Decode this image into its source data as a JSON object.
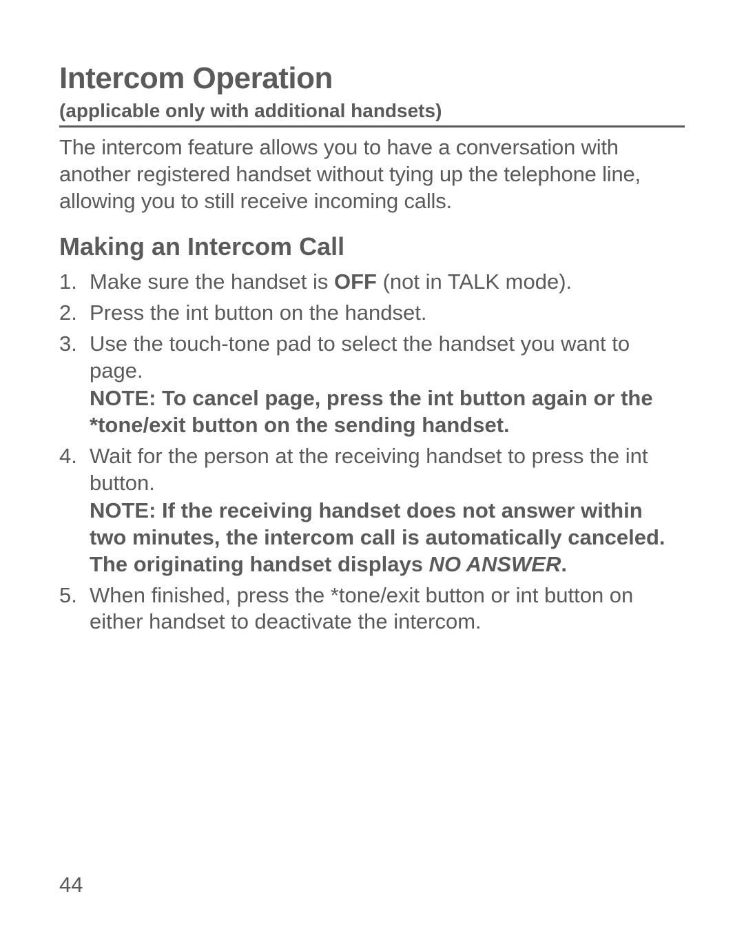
{
  "header": {
    "title": "Intercom Operation",
    "subtitle": "(applicable only with additional handsets)"
  },
  "intro": "The intercom feature allows you to have a conversation with another registered handset without tying up the telephone line, allowing you to still receive incoming calls.",
  "section_title": "Making an Intercom Call",
  "steps": {
    "s1_a": "Make sure the handset is ",
    "s1_off": "OFF",
    "s1_b": " (not in TALK mode).",
    "s2": "Press the int button on the handset.",
    "s3_a": "Use the touch-tone pad to select the handset you want to page.",
    "s3_note": "NOTE: To cancel page, press the int button again or the *tone/exit button on the sending handset.",
    "s4_a": "Wait for the person at the receiving handset to press the int button.",
    "s4_note_a": "NOTE: If the receiving handset does not answer within two minutes, the intercom call is automatically canceled. The originating handset displays ",
    "s4_note_ital": "NO ANSWER",
    "s4_note_end": ".",
    "s5": "When finished, press the *tone/exit button or int button on either handset to deactivate the intercom."
  },
  "page_number": "44"
}
